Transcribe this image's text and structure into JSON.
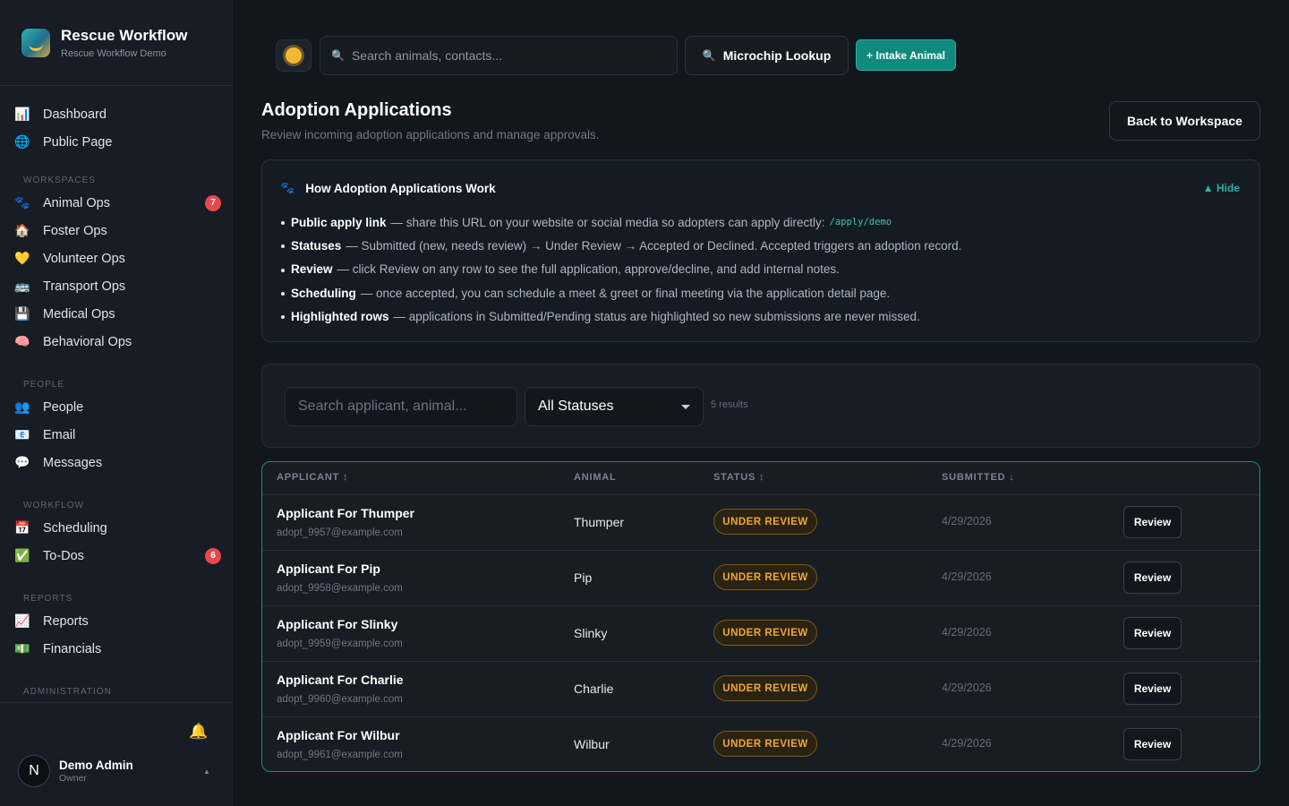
{
  "app": {
    "title": "Rescue Workflow",
    "subtitle": "Rescue Workflow Demo"
  },
  "sidebar": {
    "top_items": [
      {
        "label": "Dashboard",
        "icon": "bar-chart-icon"
      },
      {
        "label": "Public Page",
        "icon": "globe-icon"
      }
    ],
    "sections": [
      {
        "title": "WORKSPACES",
        "items": [
          {
            "label": "Animal Ops",
            "icon": "paw-icon",
            "badge": "7"
          },
          {
            "label": "Foster Ops",
            "icon": "house-icon"
          },
          {
            "label": "Volunteer Ops",
            "icon": "heart-icon"
          },
          {
            "label": "Transport Ops",
            "icon": "bus-icon"
          },
          {
            "label": "Medical Ops",
            "icon": "floppy-icon"
          },
          {
            "label": "Behavioral Ops",
            "icon": "brain-icon"
          }
        ]
      },
      {
        "title": "PEOPLE",
        "items": [
          {
            "label": "People",
            "icon": "people-icon"
          },
          {
            "label": "Email",
            "icon": "email-icon"
          },
          {
            "label": "Messages",
            "icon": "chat-bubble-icon"
          }
        ]
      },
      {
        "title": "WORKFLOW",
        "items": [
          {
            "label": "Scheduling",
            "icon": "calendar-icon"
          },
          {
            "label": "To-Dos",
            "icon": "checkbox-icon",
            "badge": "6"
          }
        ]
      },
      {
        "title": "REPORTS",
        "items": [
          {
            "label": "Reports",
            "icon": "line-chart-icon"
          },
          {
            "label": "Financials",
            "icon": "money-icon"
          }
        ]
      },
      {
        "title": "ADMINISTRATION",
        "items": []
      }
    ],
    "user": {
      "initial": "N",
      "name": "Demo Admin",
      "role": "Owner"
    }
  },
  "topbar": {
    "search_placeholder": "Search animals, contacts...",
    "microchip_label": "Microchip Lookup",
    "intake_label": "+ Intake Animal"
  },
  "page": {
    "title": "Adoption Applications",
    "subtitle": "Review incoming adoption applications and manage approvals.",
    "back_label": "Back to Workspace"
  },
  "info": {
    "title": "How Adoption Applications Work",
    "hide_label": "▲ Hide",
    "items": [
      {
        "term": "Public apply link",
        "text": "— share this URL on your website or social media so adopters can apply directly:",
        "code": "/apply/demo"
      },
      {
        "term": "Statuses",
        "text": "— Submitted (new, needs review) → Under Review → Accepted or Declined. Accepted triggers an adoption record.",
        "code": ""
      },
      {
        "term": "Review",
        "text": "— click Review on any row to see the full application, approve/decline, and add internal notes.",
        "code": ""
      },
      {
        "term": "Scheduling",
        "text": "— once accepted, you can schedule a meet & greet or final meeting via the application detail page.",
        "code": ""
      },
      {
        "term": "Highlighted rows",
        "text": "— applications in Submitted/Pending status are highlighted so new submissions are never missed.",
        "code": ""
      }
    ]
  },
  "filters": {
    "search_placeholder": "Search applicant, animal...",
    "status_selected": "All Statuses",
    "results": "5 results"
  },
  "table": {
    "headers": {
      "applicant": "APPLICANT ↕",
      "animal": "ANIMAL",
      "status": "STATUS ↕",
      "submitted": "SUBMITTED ↓"
    },
    "rows": [
      {
        "name": "Applicant For Thumper",
        "email": "adopt_9957@example.com",
        "animal": "Thumper",
        "status": "UNDER REVIEW",
        "date": "4/29/2026",
        "action": "Review"
      },
      {
        "name": "Applicant For Pip",
        "email": "adopt_9958@example.com",
        "animal": "Pip",
        "status": "UNDER REVIEW",
        "date": "4/29/2026",
        "action": "Review"
      },
      {
        "name": "Applicant For Slinky",
        "email": "adopt_9959@example.com",
        "animal": "Slinky",
        "status": "UNDER REVIEW",
        "date": "4/29/2026",
        "action": "Review"
      },
      {
        "name": "Applicant For Charlie",
        "email": "adopt_9960@example.com",
        "animal": "Charlie",
        "status": "UNDER REVIEW",
        "date": "4/29/2026",
        "action": "Review"
      },
      {
        "name": "Applicant For Wilbur",
        "email": "adopt_9961@example.com",
        "animal": "Wilbur",
        "status": "UNDER REVIEW",
        "date": "4/29/2026",
        "action": "Review"
      }
    ]
  },
  "colors": {
    "accent": "#0f8a7c",
    "status_under_review": "#f0a832",
    "badge": "#e5484d"
  }
}
